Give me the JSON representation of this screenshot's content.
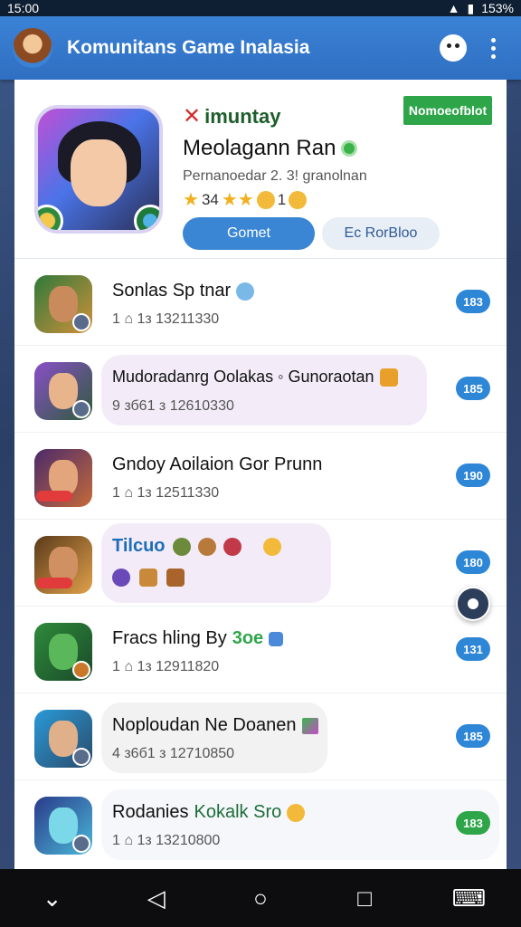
{
  "status_bar": {
    "time": "15:00",
    "battery": "153%"
  },
  "app_bar": {
    "title": "Komunitans Game Inalasia"
  },
  "profile": {
    "tag": "imuntay",
    "action": "Nomoeofblot",
    "name": "Meolagann Ran",
    "subtitle": "Pernanoedar 2. 3! granolnan",
    "stats": "34",
    "stats2": "1",
    "primary_button": "Gomet",
    "secondary_button": "Ec RorBloo"
  },
  "items": [
    {
      "title": "Sonlas Sp tnar",
      "meta": "1 ⌂ 1з 13211330",
      "count": "183",
      "count_color": "#2e86d6"
    },
    {
      "title": "Mudoradanrg Oolakas ◦ Gunoraotan",
      "meta": "9 зб61 з 12610330",
      "count": "185",
      "count_color": "#2e86d6"
    },
    {
      "title": "Gndoy Aoilaion Gor Prunn",
      "meta": "1 ⌂ 1з 12511330",
      "count": "190",
      "count_color": "#2e86d6"
    },
    {
      "title": "Tilcuo",
      "meta": "",
      "count": "180",
      "count_color": "#2e86d6"
    },
    {
      "title": "Fracs hling By",
      "title_accent": "3oe",
      "meta": "1 ⌂ 1з 12911820",
      "count": "131",
      "count_color": "#2e86d6"
    },
    {
      "title": "Noploudan Ne Doanen",
      "meta": "4 з6б1 з 12710850",
      "count": "185",
      "count_color": "#2e86d6"
    },
    {
      "title": "Rodanies",
      "title_accent": "Kokalk Sro",
      "meta": "1 ⌂ 1з 13210800",
      "count": "183",
      "count_color": "#2fa54a"
    }
  ]
}
